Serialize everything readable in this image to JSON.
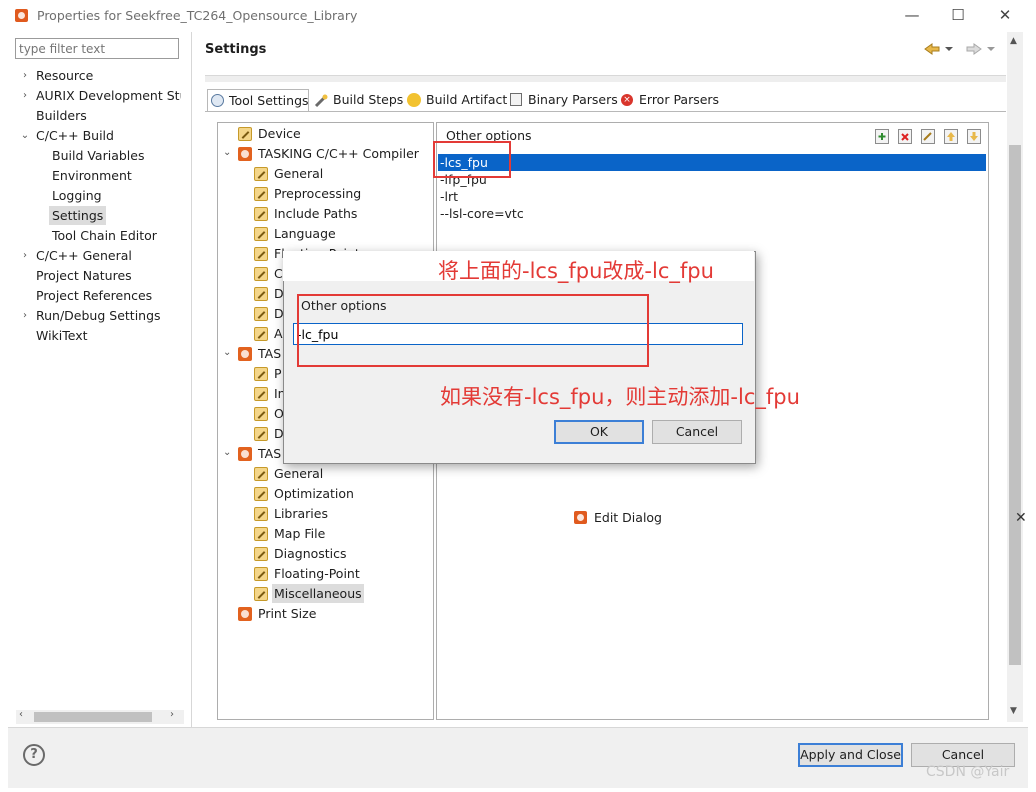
{
  "window": {
    "title": "Properties for Seekfree_TC264_Opensource_Library",
    "minimize": "—",
    "maximize": "☐",
    "close": "✕"
  },
  "filter": {
    "placeholder": "type filter text"
  },
  "nav": [
    {
      "label": "Resource",
      "arrow": "›"
    },
    {
      "label": "AURIX Development Studio",
      "arrow": "›"
    },
    {
      "label": "Builders",
      "arrow": ""
    },
    {
      "label": "C/C++ Build",
      "arrow": "⌄"
    },
    {
      "label": "Build Variables",
      "arrow": ""
    },
    {
      "label": "Environment",
      "arrow": ""
    },
    {
      "label": "Logging",
      "arrow": ""
    },
    {
      "label": "Settings",
      "arrow": ""
    },
    {
      "label": "Tool Chain Editor",
      "arrow": ""
    },
    {
      "label": "C/C++ General",
      "arrow": "›"
    },
    {
      "label": "Project Natures",
      "arrow": ""
    },
    {
      "label": "Project References",
      "arrow": ""
    },
    {
      "label": "Run/Debug Settings",
      "arrow": "›"
    },
    {
      "label": "WikiText",
      "arrow": ""
    }
  ],
  "header": {
    "title": "Settings"
  },
  "tabs": [
    {
      "label": "Tool Settings"
    },
    {
      "label": "Build Steps"
    },
    {
      "label": "Build Artifact"
    },
    {
      "label": "Binary Parsers"
    },
    {
      "label": "Error Parsers"
    }
  ],
  "tree": [
    {
      "label": "Device"
    },
    {
      "label": "TASKING C/C++ Compiler"
    },
    {
      "label": "General"
    },
    {
      "label": "Preprocessing"
    },
    {
      "label": "Include Paths"
    },
    {
      "label": "Language"
    },
    {
      "label": "Floating-Point"
    },
    {
      "label": "C"
    },
    {
      "label": "D"
    },
    {
      "label": "D"
    },
    {
      "label": "A"
    },
    {
      "label": "TAS"
    },
    {
      "label": "P"
    },
    {
      "label": "In"
    },
    {
      "label": "O"
    },
    {
      "label": "D"
    },
    {
      "label": "TAS"
    },
    {
      "label": "General"
    },
    {
      "label": "Optimization"
    },
    {
      "label": "Libraries"
    },
    {
      "label": "Map File"
    },
    {
      "label": "Diagnostics"
    },
    {
      "label": "Floating-Point"
    },
    {
      "label": "Miscellaneous"
    },
    {
      "label": "Print Size"
    }
  ],
  "options": {
    "label": "Other options",
    "items": [
      "-lcs_fpu",
      "-lfp_fpu",
      "-lrt",
      "--lsl-core=vtc"
    ]
  },
  "dialog": {
    "title": "Edit Dialog",
    "field_label": "Other options",
    "value": "-lc_fpu",
    "ok": "OK",
    "cancel": "Cancel"
  },
  "annotations": {
    "top": "将上面的-lcs_fpu改成-lc_fpu",
    "bottom": "如果没有-lcs_fpu，则主动添加-lc_fpu",
    "color": "#e33a36"
  },
  "footer": {
    "help": "?",
    "apply": "Apply and Close",
    "cancel": "Cancel"
  },
  "watermark": "CSDN @Yair"
}
